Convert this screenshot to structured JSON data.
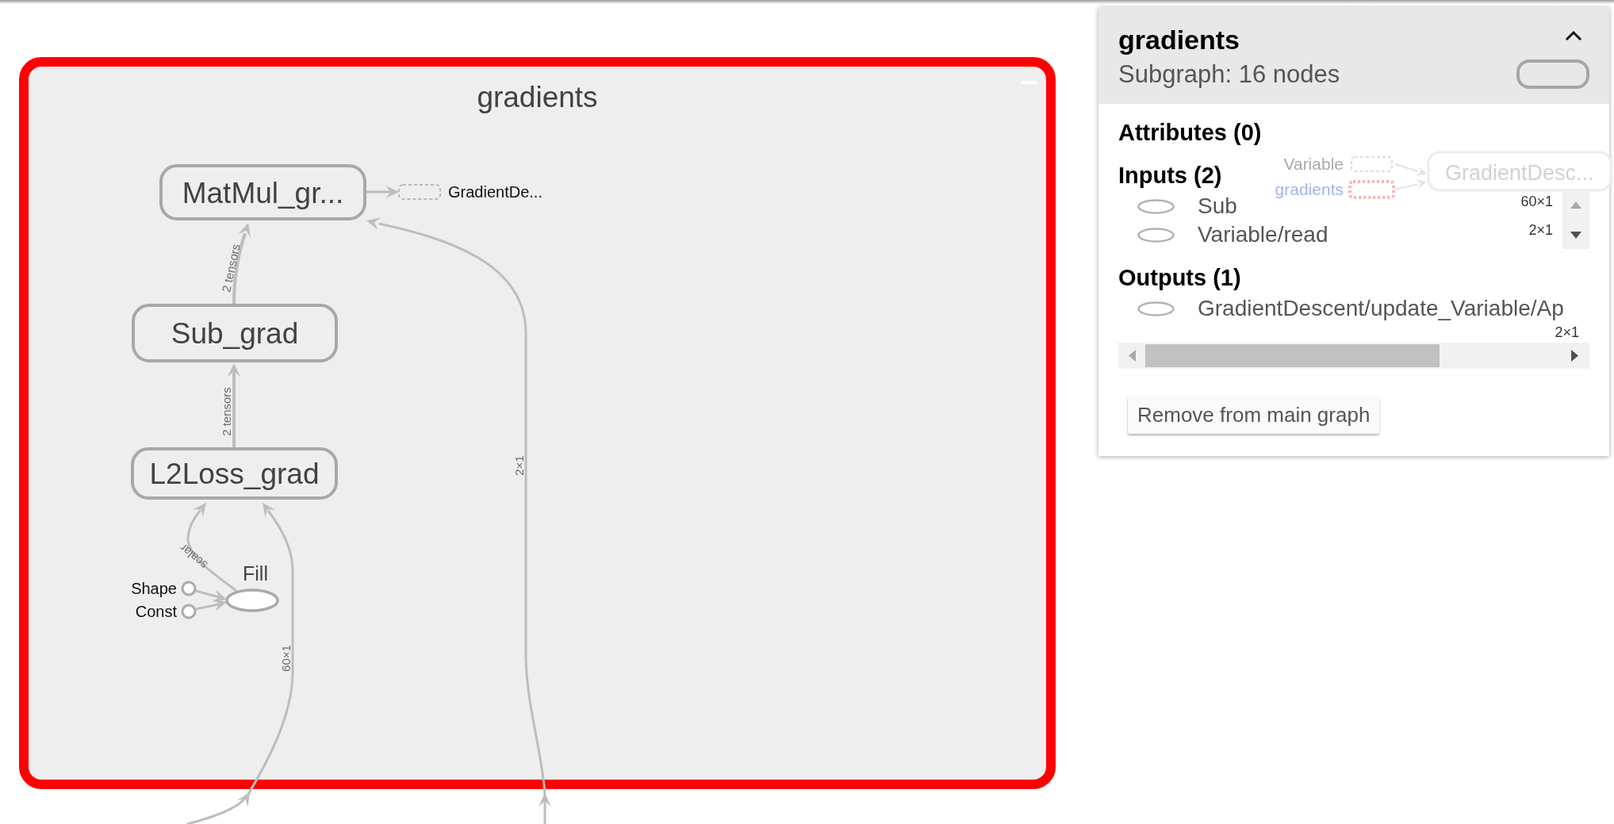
{
  "graph": {
    "group": {
      "title": "gradients",
      "selected": true
    },
    "nodes": [
      {
        "kind": "group",
        "label": "MatMul_gr..."
      },
      {
        "kind": "group",
        "label": "Sub_grad"
      },
      {
        "kind": "group",
        "label": "L2Loss_grad"
      },
      {
        "kind": "op",
        "label": "Fill"
      },
      {
        "kind": "constant",
        "label": "Shape"
      },
      {
        "kind": "constant",
        "label": "Const"
      },
      {
        "kind": "bridge",
        "label": "GradientDe..."
      }
    ],
    "edges": [
      {
        "label": "2 tensors"
      },
      {
        "label": "2 tensors"
      },
      {
        "label": "scalar"
      },
      {
        "label": "60×1"
      },
      {
        "label": "2×1"
      }
    ]
  },
  "info_panel": {
    "title": "gradients",
    "subtitle": "Subgraph: 16 nodes",
    "expanded": true,
    "preview": {
      "inputs": [
        {
          "label": "Variable",
          "selected": false
        },
        {
          "label": "gradients",
          "selected": true
        }
      ],
      "node": "GradientDesc..."
    },
    "sections": [
      {
        "heading": "Attributes (0)"
      },
      {
        "heading": "Inputs (2)",
        "items": [
          {
            "name": "Sub",
            "shape": "60×1"
          },
          {
            "name": "Variable/read",
            "shape": "2×1"
          }
        ]
      },
      {
        "heading": "Outputs (1)",
        "items": [
          {
            "name": "GradientDescent/update_Variable/Ap",
            "shape": "2×1"
          }
        ]
      }
    ],
    "button": "Remove from main graph"
  }
}
